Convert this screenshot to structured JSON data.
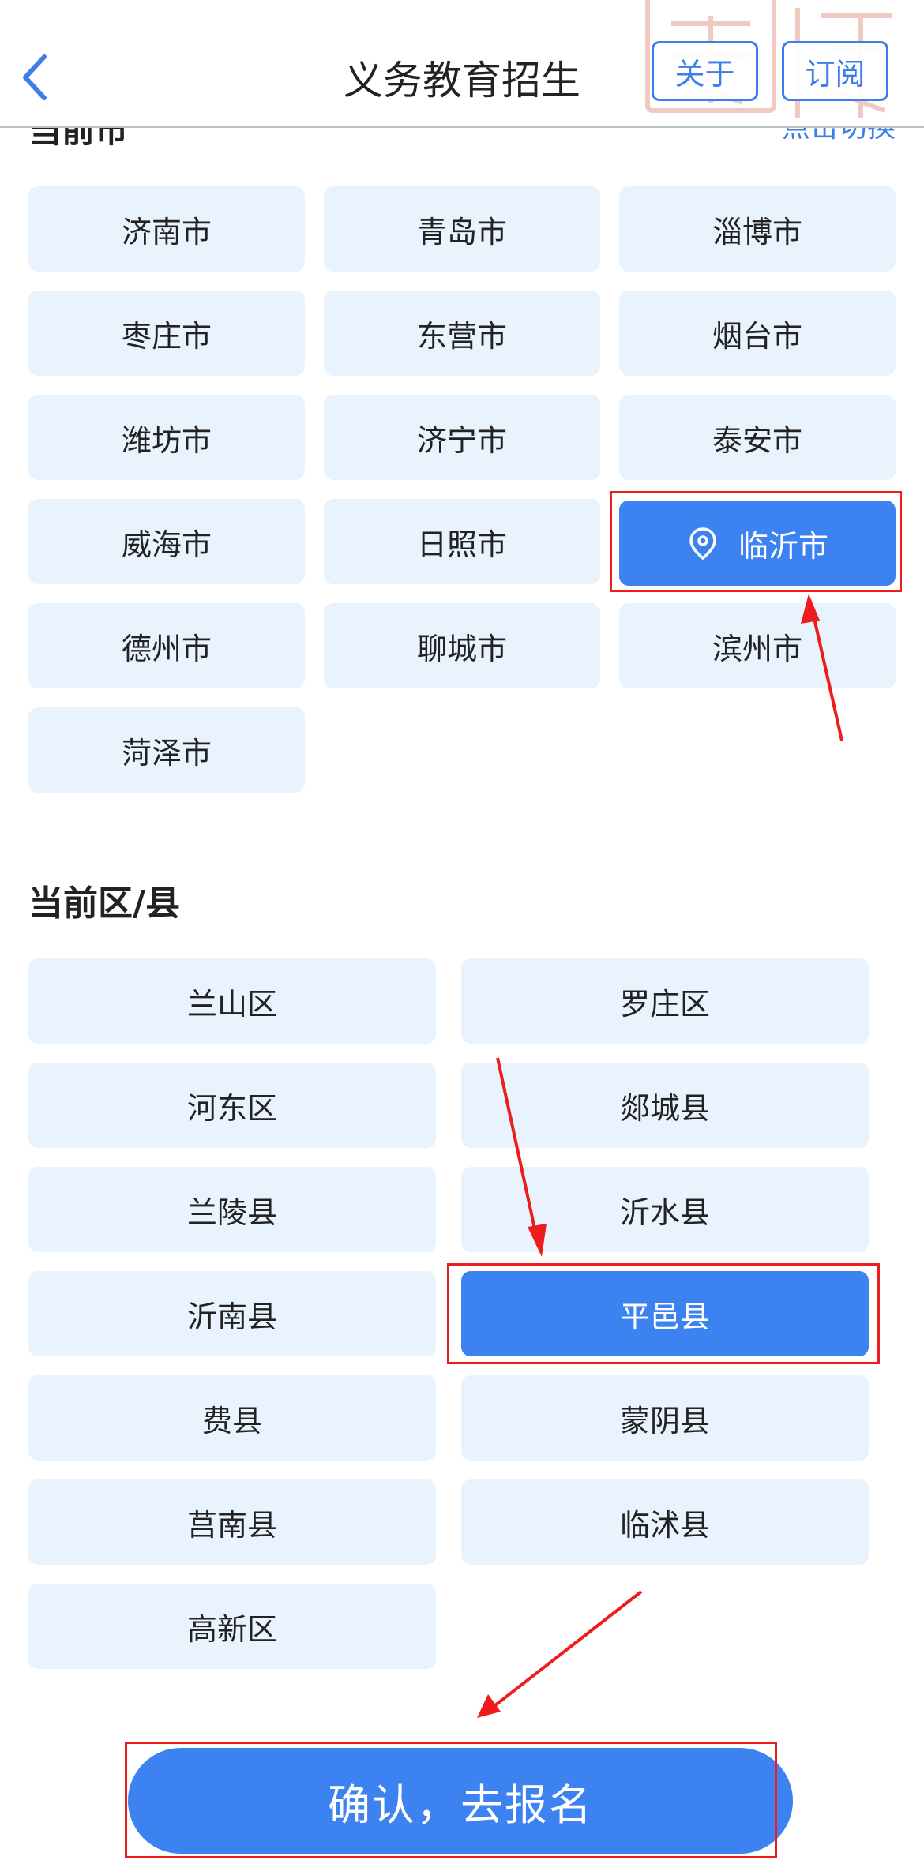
{
  "header": {
    "title": "义务教育招生",
    "about_label": "关于",
    "subscribe_label": "订阅",
    "back_icon": "chevron-left-icon"
  },
  "city_section": {
    "heading": "当前市",
    "switch_label": "点击切换",
    "items": [
      "济南市",
      "青岛市",
      "淄博市",
      "枣庄市",
      "东营市",
      "烟台市",
      "潍坊市",
      "济宁市",
      "泰安市",
      "威海市",
      "日照市",
      "临沂市",
      "德州市",
      "聊城市",
      "滨州市",
      "菏泽市"
    ],
    "selected": "临沂市",
    "selected_icon": "location-pin-icon"
  },
  "county_section": {
    "heading": "当前区/县",
    "items": [
      "兰山区",
      "罗庄区",
      "河东区",
      "郯城县",
      "兰陵县",
      "沂水县",
      "沂南县",
      "平邑县",
      "费县",
      "蒙阴县",
      "莒南县",
      "临沭县",
      "高新区"
    ],
    "selected": "平邑县"
  },
  "confirm_label": "确认，去报名",
  "colors": {
    "accent": "#3d82f1",
    "cell_background": "#e8f3fe",
    "annotation_red": "#ee1c1c"
  }
}
